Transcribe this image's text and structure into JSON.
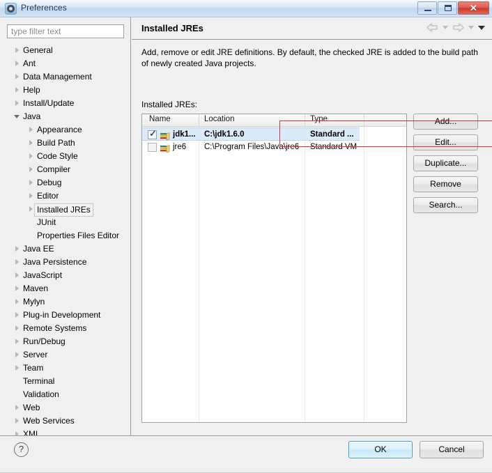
{
  "window": {
    "title": "Preferences",
    "icon": "gear-icon",
    "controls": {
      "minimize": "minimize-icon",
      "maximize": "maximize-icon",
      "close": "✕"
    }
  },
  "sidebar": {
    "filter": {
      "placeholder": "type filter text",
      "value": ""
    },
    "items": [
      {
        "label": "General",
        "depth": 0,
        "arrow": "collapsed",
        "selected": false
      },
      {
        "label": "Ant",
        "depth": 0,
        "arrow": "collapsed",
        "selected": false
      },
      {
        "label": "Data Management",
        "depth": 0,
        "arrow": "collapsed",
        "selected": false
      },
      {
        "label": "Help",
        "depth": 0,
        "arrow": "collapsed",
        "selected": false
      },
      {
        "label": "Install/Update",
        "depth": 0,
        "arrow": "collapsed",
        "selected": false
      },
      {
        "label": "Java",
        "depth": 0,
        "arrow": "expanded",
        "selected": false
      },
      {
        "label": "Appearance",
        "depth": 1,
        "arrow": "collapsed",
        "selected": false
      },
      {
        "label": "Build Path",
        "depth": 1,
        "arrow": "collapsed",
        "selected": false
      },
      {
        "label": "Code Style",
        "depth": 1,
        "arrow": "collapsed",
        "selected": false
      },
      {
        "label": "Compiler",
        "depth": 1,
        "arrow": "collapsed",
        "selected": false
      },
      {
        "label": "Debug",
        "depth": 1,
        "arrow": "collapsed",
        "selected": false
      },
      {
        "label": "Editor",
        "depth": 1,
        "arrow": "collapsed",
        "selected": false
      },
      {
        "label": "Installed JREs",
        "depth": 1,
        "arrow": "collapsed",
        "selected": true
      },
      {
        "label": "JUnit",
        "depth": 1,
        "arrow": "none",
        "selected": false
      },
      {
        "label": "Properties Files Editor",
        "depth": 1,
        "arrow": "none",
        "selected": false
      },
      {
        "label": "Java EE",
        "depth": 0,
        "arrow": "collapsed",
        "selected": false
      },
      {
        "label": "Java Persistence",
        "depth": 0,
        "arrow": "collapsed",
        "selected": false
      },
      {
        "label": "JavaScript",
        "depth": 0,
        "arrow": "collapsed",
        "selected": false
      },
      {
        "label": "Maven",
        "depth": 0,
        "arrow": "collapsed",
        "selected": false
      },
      {
        "label": "Mylyn",
        "depth": 0,
        "arrow": "collapsed",
        "selected": false
      },
      {
        "label": "Plug-in Development",
        "depth": 0,
        "arrow": "collapsed",
        "selected": false
      },
      {
        "label": "Remote Systems",
        "depth": 0,
        "arrow": "collapsed",
        "selected": false
      },
      {
        "label": "Run/Debug",
        "depth": 0,
        "arrow": "collapsed",
        "selected": false
      },
      {
        "label": "Server",
        "depth": 0,
        "arrow": "collapsed",
        "selected": false
      },
      {
        "label": "Team",
        "depth": 0,
        "arrow": "collapsed",
        "selected": false
      },
      {
        "label": "Terminal",
        "depth": 0,
        "arrow": "none",
        "selected": false
      },
      {
        "label": "Validation",
        "depth": 0,
        "arrow": "none",
        "selected": false
      },
      {
        "label": "Web",
        "depth": 0,
        "arrow": "collapsed",
        "selected": false
      },
      {
        "label": "Web Services",
        "depth": 0,
        "arrow": "collapsed",
        "selected": false
      },
      {
        "label": "XML",
        "depth": 0,
        "arrow": "collapsed",
        "selected": false
      }
    ]
  },
  "page": {
    "title": "Installed JREs",
    "description": "Add, remove or edit JRE definitions. By default, the checked JRE is added to the build path of newly created Java projects.",
    "nav": {
      "back": "back-arrow-icon",
      "back_menu": "chevron-down-icon",
      "forward": "forward-arrow-icon",
      "forward_menu": "chevron-down-icon",
      "view_menu": "chevron-down-icon"
    },
    "table_label": "Installed JREs:",
    "table": {
      "columns": [
        "Name",
        "Location",
        "Type"
      ],
      "rows": [
        {
          "checked": true,
          "selected": true,
          "icon": "jre-icon",
          "name": "jdk1...",
          "location": "C:\\jdk1.6.0",
          "type": "Standard ..."
        },
        {
          "checked": false,
          "selected": false,
          "icon": "jre-icon",
          "name": "jre6",
          "location": "C:\\Program Files\\Java\\jre6",
          "type": "Standard VM"
        }
      ]
    },
    "buttons": [
      {
        "label": "Add..."
      },
      {
        "label": "Edit..."
      },
      {
        "label": "Duplicate..."
      },
      {
        "label": "Remove"
      },
      {
        "label": "Search..."
      }
    ]
  },
  "footer": {
    "help": "?",
    "ok": "OK",
    "cancel": "Cancel"
  },
  "annotation": {
    "color": "#d83434",
    "target": "selected-jre-row"
  }
}
